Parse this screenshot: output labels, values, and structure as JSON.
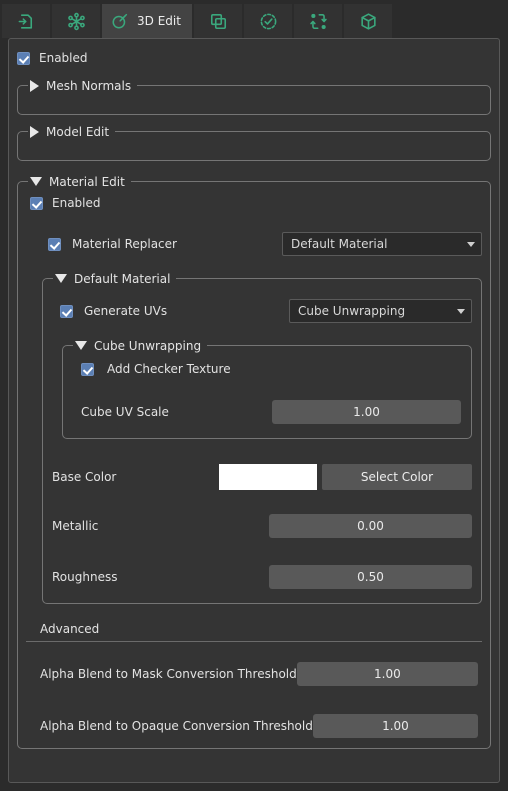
{
  "tabs": [
    {
      "icon": "import-icon",
      "label": "",
      "active": false
    },
    {
      "icon": "node-graph-icon",
      "label": "",
      "active": false
    },
    {
      "icon": "paint-brush-icon",
      "label": "3D Edit",
      "active": true
    },
    {
      "icon": "duplicate-icon",
      "label": "",
      "active": false
    },
    {
      "icon": "check-circle-icon",
      "label": "",
      "active": false
    },
    {
      "icon": "transfer-icon",
      "label": "",
      "active": false
    },
    {
      "icon": "cube-export-icon",
      "label": "",
      "active": false
    }
  ],
  "panel": {
    "enabled_label": "Enabled",
    "groups": {
      "mesh_normals": {
        "title": "Mesh Normals",
        "expanded": false
      },
      "model_edit": {
        "title": "Model Edit",
        "expanded": false
      },
      "material_edit": {
        "title": "Material Edit",
        "expanded": true,
        "enabled_label": "Enabled",
        "material_replacer": {
          "label": "Material Replacer",
          "value": "Default Material"
        },
        "default_material": {
          "title": "Default Material",
          "expanded": true,
          "generate_uvs": {
            "label": "Generate UVs",
            "value": "Cube Unwrapping"
          },
          "cube_unwrapping": {
            "title": "Cube Unwrapping",
            "expanded": true,
            "add_checker_texture_label": "Add Checker Texture",
            "cube_uv_scale": {
              "label": "Cube UV Scale",
              "value": "1.00"
            }
          },
          "base_color": {
            "label": "Base Color",
            "swatch_color": "#ffffff",
            "button_label": "Select Color"
          },
          "metallic": {
            "label": "Metallic",
            "value": "0.00"
          },
          "roughness": {
            "label": "Roughness",
            "value": "0.50"
          }
        },
        "advanced": {
          "title": "Advanced",
          "alpha_mask": {
            "label": "Alpha Blend to Mask Conversion Threshold",
            "value": "1.00"
          },
          "alpha_opaque": {
            "label": "Alpha Blend to Opaque Conversion Threshold",
            "value": "1.00"
          }
        }
      }
    }
  },
  "colors": {
    "accent_green": "#3aa87d",
    "checkbox_blue": "#5b7fb4",
    "panel_bg": "#343434",
    "window_bg": "#2b2b2b"
  }
}
